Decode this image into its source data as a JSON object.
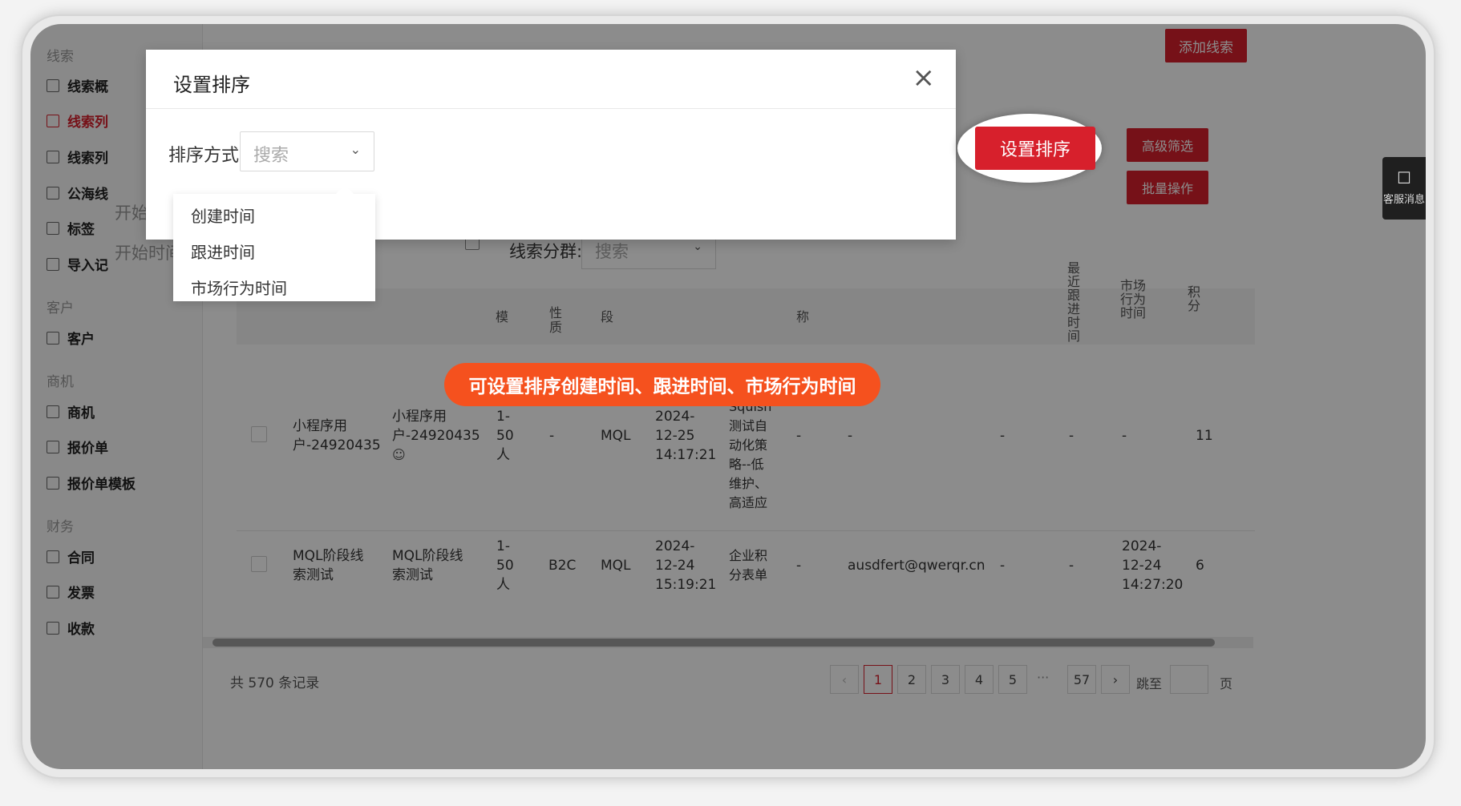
{
  "sidebar": {
    "groups": {
      "leads": "线索",
      "customers": "客户",
      "opportunities": "商机",
      "finance": "财务"
    },
    "items": [
      {
        "label": "线索概",
        "icon": "chart-icon"
      },
      {
        "label": "线索列",
        "icon": "list-search-icon"
      },
      {
        "label": "线索列",
        "icon": "list-search-icon"
      },
      {
        "label": "公海线",
        "icon": "list-search-icon"
      },
      {
        "label": "标签",
        "icon": "tag-icon"
      },
      {
        "label": "导入记",
        "icon": "list-search-icon"
      },
      {
        "label": "客户",
        "icon": "chart-icon"
      },
      {
        "label": "商机",
        "icon": "chart-icon"
      },
      {
        "label": "报价单",
        "icon": "chart-icon"
      },
      {
        "label": "报价单模板",
        "icon": "chart-icon"
      },
      {
        "label": "合同",
        "icon": "doc-icon"
      },
      {
        "label": "发票",
        "icon": "doc-icon"
      },
      {
        "label": "收款",
        "icon": "doc-icon"
      }
    ]
  },
  "toolbar": {
    "add_lead": "添加线索",
    "advanced_filter": "高级筛选",
    "batch_ops": "批量操作",
    "chat_label": "客服消息"
  },
  "filters": {
    "start_time_1": "开始时间",
    "start_time_2": "开始时间",
    "group_label": "线索分群:",
    "group_placeholder": "搜索"
  },
  "table": {
    "headers": {
      "scale": "模",
      "nature": "性质",
      "stage": "段",
      "name": "称",
      "last_follow": "最近跟进时间",
      "market_time": "市场行为时间",
      "points": "积分"
    },
    "rows": [
      {
        "name": "小程序用户-24920435",
        "nickname": "小程序用户-24920435",
        "scale": "1-50人",
        "nature": "-",
        "stage": "MQL",
        "created": "2024-12-25 14:17:21",
        "source": "Squish测试自动化策略--低维护、高适应",
        "c1": "-",
        "email": "-",
        "c2": "-",
        "last_follow": "-",
        "market_time": "-",
        "points": "11"
      },
      {
        "name": "MQL阶段线索测试",
        "nickname": "MQL阶段线索测试",
        "scale": "1-50人",
        "nature": "B2C",
        "stage": "MQL",
        "created": "2024-12-24 15:19:21",
        "source": "企业积分表单",
        "c1": "-",
        "email": "ausdfert@qwerqr.cn",
        "c2": "-",
        "last_follow": "-",
        "market_time": "2024-12-24 14:27:20",
        "points": "6"
      }
    ]
  },
  "pagination": {
    "total": "共 570 条记录",
    "pages": [
      "1",
      "2",
      "3",
      "4",
      "5"
    ],
    "ellipsis": "···",
    "last": "57",
    "prev": "‹",
    "next": "›",
    "jump_label": "跳至",
    "page_suffix": "页"
  },
  "modal": {
    "title": "设置排序",
    "close": "×",
    "sort_label": "排序方式:",
    "sort_placeholder": "搜索",
    "options": [
      "创建时间",
      "跟进时间",
      "市场行为时间"
    ]
  },
  "callout_button": "设置排序",
  "banner": "可设置排序创建时间、跟进时间、市场行为时间",
  "colors": {
    "brand_red": "#d7202c",
    "banner_orange": "#f5511e"
  }
}
